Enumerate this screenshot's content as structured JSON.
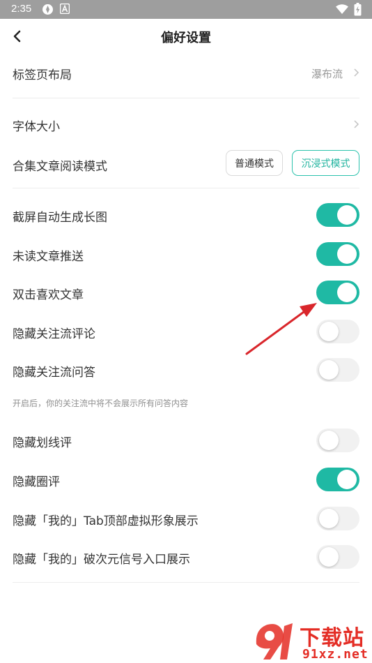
{
  "status_bar": {
    "time": "2:35"
  },
  "header": {
    "title": "偏好设置"
  },
  "settings": {
    "tab_layout": {
      "label": "标签页布局",
      "value": "瀑布流"
    },
    "font_size": {
      "label": "字体大小"
    },
    "collection_mode": {
      "label": "合集文章阅读模式",
      "normal_label": "普通模式",
      "immersive_label": "沉浸式模式",
      "selected": "沉浸式模式"
    },
    "toggles": [
      {
        "label": "截屏自动生成长图",
        "on": true
      },
      {
        "label": "未读文章推送",
        "on": true
      },
      {
        "label": "双击喜欢文章",
        "on": true
      },
      {
        "label": "隐藏关注流评论",
        "on": false
      },
      {
        "label": "隐藏关注流问答",
        "on": false
      },
      {
        "label": "隐藏划线评",
        "on": false
      },
      {
        "label": "隐藏圈评",
        "on": true
      },
      {
        "label": "隐藏「我的」Tab顶部虚拟形象展示",
        "on": false
      },
      {
        "label": "隐藏「我的」破次元信号入口展示",
        "on": false
      }
    ],
    "qa_hint": "开启后，你的关注流中将不会展示所有问答内容"
  },
  "watermark": {
    "brand": "下载站",
    "domain": "91xz.net"
  },
  "colors": {
    "accent": "#1fb9a4",
    "status_bar": "#9e9e9e",
    "annotation_arrow": "#d9262b",
    "watermark": "#e42d25"
  },
  "icons": {
    "back": "chevron-left-icon",
    "row_arrow": "chevron-right-icon",
    "wifi": "wifi-icon",
    "battery": "battery-charging-icon"
  }
}
